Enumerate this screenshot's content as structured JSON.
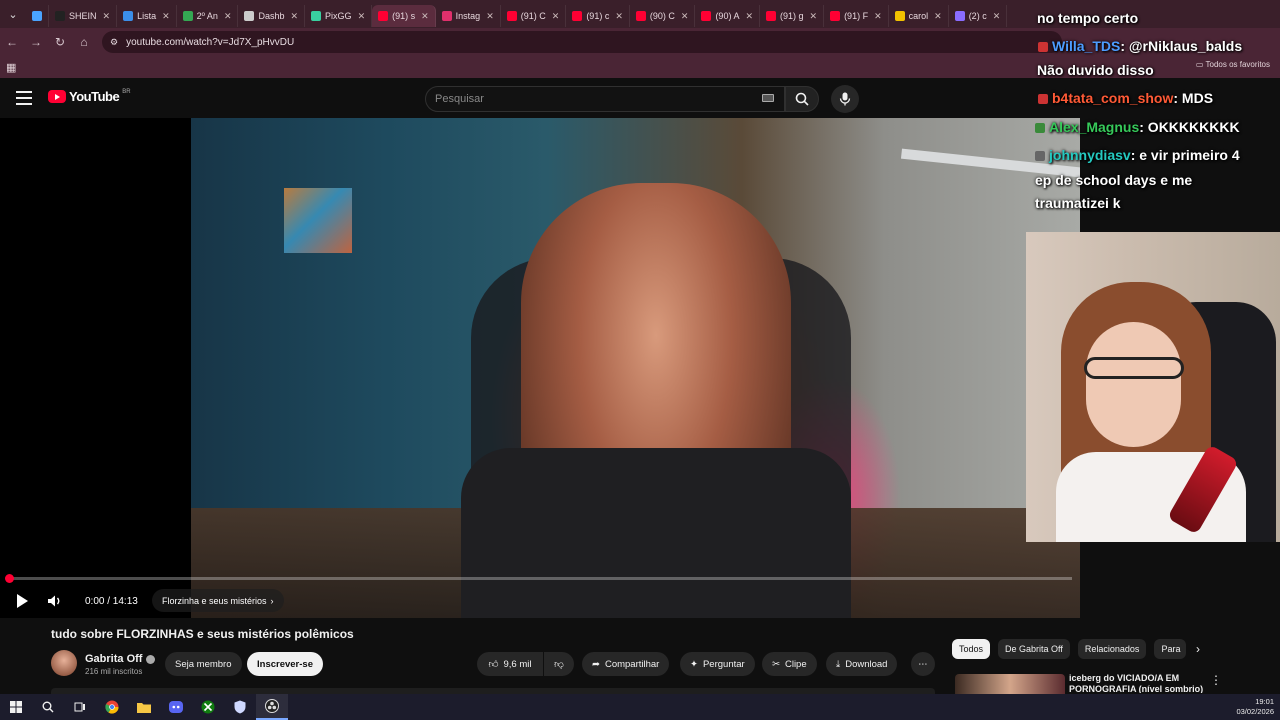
{
  "browser": {
    "tabs": [
      {
        "label": "",
        "favicon_color": "#4aa3ff"
      },
      {
        "label": "SHEIN",
        "favicon_color": "#222222"
      },
      {
        "label": "Lista",
        "favicon_color": "#3b8eea"
      },
      {
        "label": "2º An",
        "favicon_color": "#34a853"
      },
      {
        "label": "Dashb",
        "favicon_color": "#cccccc"
      },
      {
        "label": "PixGG",
        "favicon_color": "#39d0a0"
      },
      {
        "label": "(91) s",
        "favicon_color": "#ff0033",
        "active": true
      },
      {
        "label": "Instag",
        "favicon_color": "#e1306c"
      },
      {
        "label": "(91) C",
        "favicon_color": "#ff0033"
      },
      {
        "label": "(91) c",
        "favicon_color": "#ff0033"
      },
      {
        "label": "(90) C",
        "favicon_color": "#ff0033"
      },
      {
        "label": "(90) A",
        "favicon_color": "#ff0033"
      },
      {
        "label": "(91) g",
        "favicon_color": "#ff0033"
      },
      {
        "label": "(91) F",
        "favicon_color": "#ff0033"
      },
      {
        "label": "carol",
        "favicon_color": "#f2c200"
      },
      {
        "label": "(2) c",
        "favicon_color": "#8a6cff"
      }
    ],
    "url": "youtube.com/watch?v=Jd7X_pHvvDU",
    "bookmarks_label": "Todos os favoritos"
  },
  "youtube": {
    "logo_text": "YouTube",
    "country_code": "BR",
    "search_placeholder": "Pesquisar"
  },
  "player": {
    "time": "0:00 / 14:13",
    "chapter": "Florzinha e seus mistérios",
    "progress_fraction": 0.0
  },
  "stream_chat": [
    {
      "user": "",
      "message": "no tempo certo",
      "color": "#ffffff"
    },
    {
      "user": "Willa_TDS",
      "message": ": @rNiklaus_balds",
      "color": "#4d9cff"
    },
    {
      "user": "",
      "message": "Não duvido disso",
      "color": "#ffffff"
    },
    {
      "user": "b4tata_com_show",
      "message": ": MDS",
      "color": "#ff5a36"
    },
    {
      "user": "Alex_Magnus",
      "message": ": OKKKKKKKK",
      "color": "#36c95a"
    },
    {
      "user": "johnnydiasv",
      "message": ": e vir primeiro 4",
      "color": "#25c9c0"
    },
    {
      "user": "",
      "message": "ep de school days e me",
      "color": "#ffffff"
    },
    {
      "user": "",
      "message": "traumatizei k",
      "color": "#ffffff"
    }
  ],
  "video": {
    "title": "tudo sobre FLORZINHAS e seus mistérios polêmicos",
    "channel": "Gabrita Off",
    "subscribers": "216 mil inscritos",
    "member_label": "Seja membro",
    "subscribe_label": "Inscrever-se",
    "likes": "9,6 mil",
    "share_label": "Compartilhar",
    "ask_label": "Perguntar",
    "clip_label": "Clipe",
    "download_label": "Download"
  },
  "sidebar": {
    "chips": [
      "Todos",
      "De Gabrita Off",
      "Relacionados",
      "Para"
    ],
    "recommendation_title": "iceberg do VICIADO/A EM PORNOGRAFIA (nível sombrio)"
  },
  "taskbar": {
    "time": "19:01",
    "date": "03/02/2026"
  }
}
